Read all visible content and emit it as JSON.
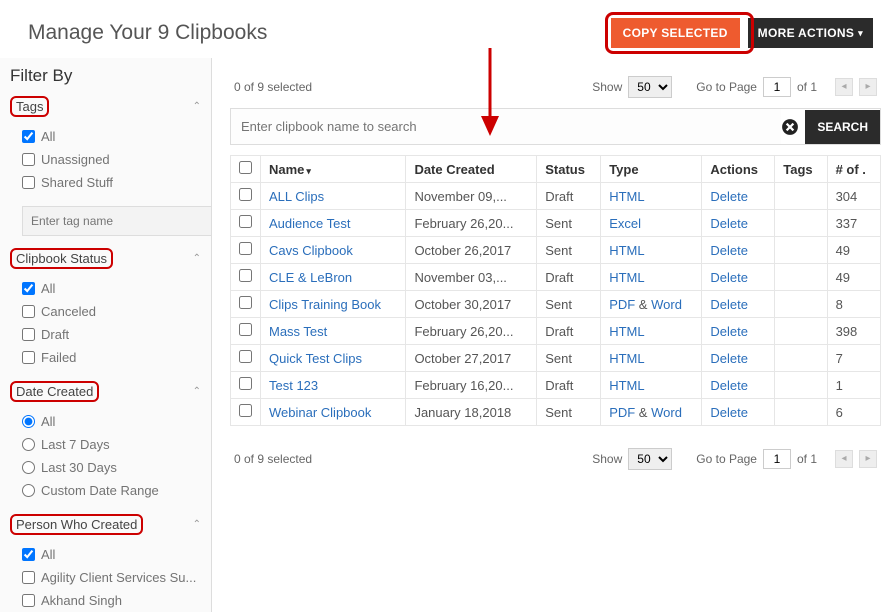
{
  "header": {
    "title": "Manage Your 9 Clipbooks",
    "copy_selected": "COPY SELECTED",
    "more_actions": "MORE ACTIONS"
  },
  "sidebar": {
    "title": "Filter By",
    "tags": {
      "label": "Tags",
      "options": [
        "All",
        "Unassigned",
        "Shared Stuff"
      ],
      "checked": [
        true,
        false,
        false
      ],
      "tag_input_placeholder": "Enter tag name"
    },
    "status": {
      "label": "Clipbook Status",
      "options": [
        "All",
        "Canceled",
        "Draft",
        "Failed"
      ],
      "checked": [
        true,
        false,
        false,
        false
      ]
    },
    "date": {
      "label": "Date Created",
      "options": [
        "All",
        "Last 7 Days",
        "Last 30 Days",
        "Custom Date Range"
      ],
      "selected": 0
    },
    "person": {
      "label": "Person Who Created",
      "options": [
        "All",
        "Agility Client Services Su...",
        "Akhand Singh"
      ],
      "checked": [
        true,
        false,
        false
      ]
    }
  },
  "tools": {
    "selected_text": "0 of 9 selected",
    "show_label": "Show",
    "show_value": "50",
    "goto_label": "Go to Page",
    "page_value": "1",
    "of_label": "of  1",
    "search_placeholder": "Enter clipbook name to search",
    "search_btn": "SEARCH"
  },
  "table": {
    "headers": {
      "name": "Name",
      "date": "Date Created",
      "status": "Status",
      "type": "Type",
      "actions": "Actions",
      "tags": "Tags",
      "count": "# of ."
    },
    "rows": [
      {
        "name": "ALL Clips",
        "date": "November 09,...",
        "status": "Draft",
        "type": [
          "HTML"
        ],
        "action": "Delete",
        "tags": "",
        "count": "304"
      },
      {
        "name": "Audience Test",
        "date": "February 26,20...",
        "status": "Sent",
        "type": [
          "Excel"
        ],
        "action": "Delete",
        "tags": "",
        "count": "337"
      },
      {
        "name": "Cavs Clipbook",
        "date": "October 26,2017",
        "status": "Sent",
        "type": [
          "HTML"
        ],
        "action": "Delete",
        "tags": "",
        "count": "49"
      },
      {
        "name": "CLE & LeBron",
        "date": "November 03,...",
        "status": "Draft",
        "type": [
          "HTML"
        ],
        "action": "Delete",
        "tags": "",
        "count": "49"
      },
      {
        "name": "Clips Training Book",
        "date": "October 30,2017",
        "status": "Sent",
        "type": [
          "PDF",
          "Word"
        ],
        "action": "Delete",
        "tags": "",
        "count": "8"
      },
      {
        "name": "Mass Test",
        "date": "February 26,20...",
        "status": "Draft",
        "type": [
          "HTML"
        ],
        "action": "Delete",
        "tags": "",
        "count": "398"
      },
      {
        "name": "Quick Test Clips",
        "date": "October 27,2017",
        "status": "Sent",
        "type": [
          "HTML"
        ],
        "action": "Delete",
        "tags": "",
        "count": "7"
      },
      {
        "name": "Test 123",
        "date": "February 16,20...",
        "status": "Draft",
        "type": [
          "HTML"
        ],
        "action": "Delete",
        "tags": "",
        "count": "1"
      },
      {
        "name": "Webinar Clipbook",
        "date": "January 18,2018",
        "status": "Sent",
        "type": [
          "PDF",
          "Word"
        ],
        "action": "Delete",
        "tags": "",
        "count": "6"
      }
    ],
    "amp": "&"
  }
}
